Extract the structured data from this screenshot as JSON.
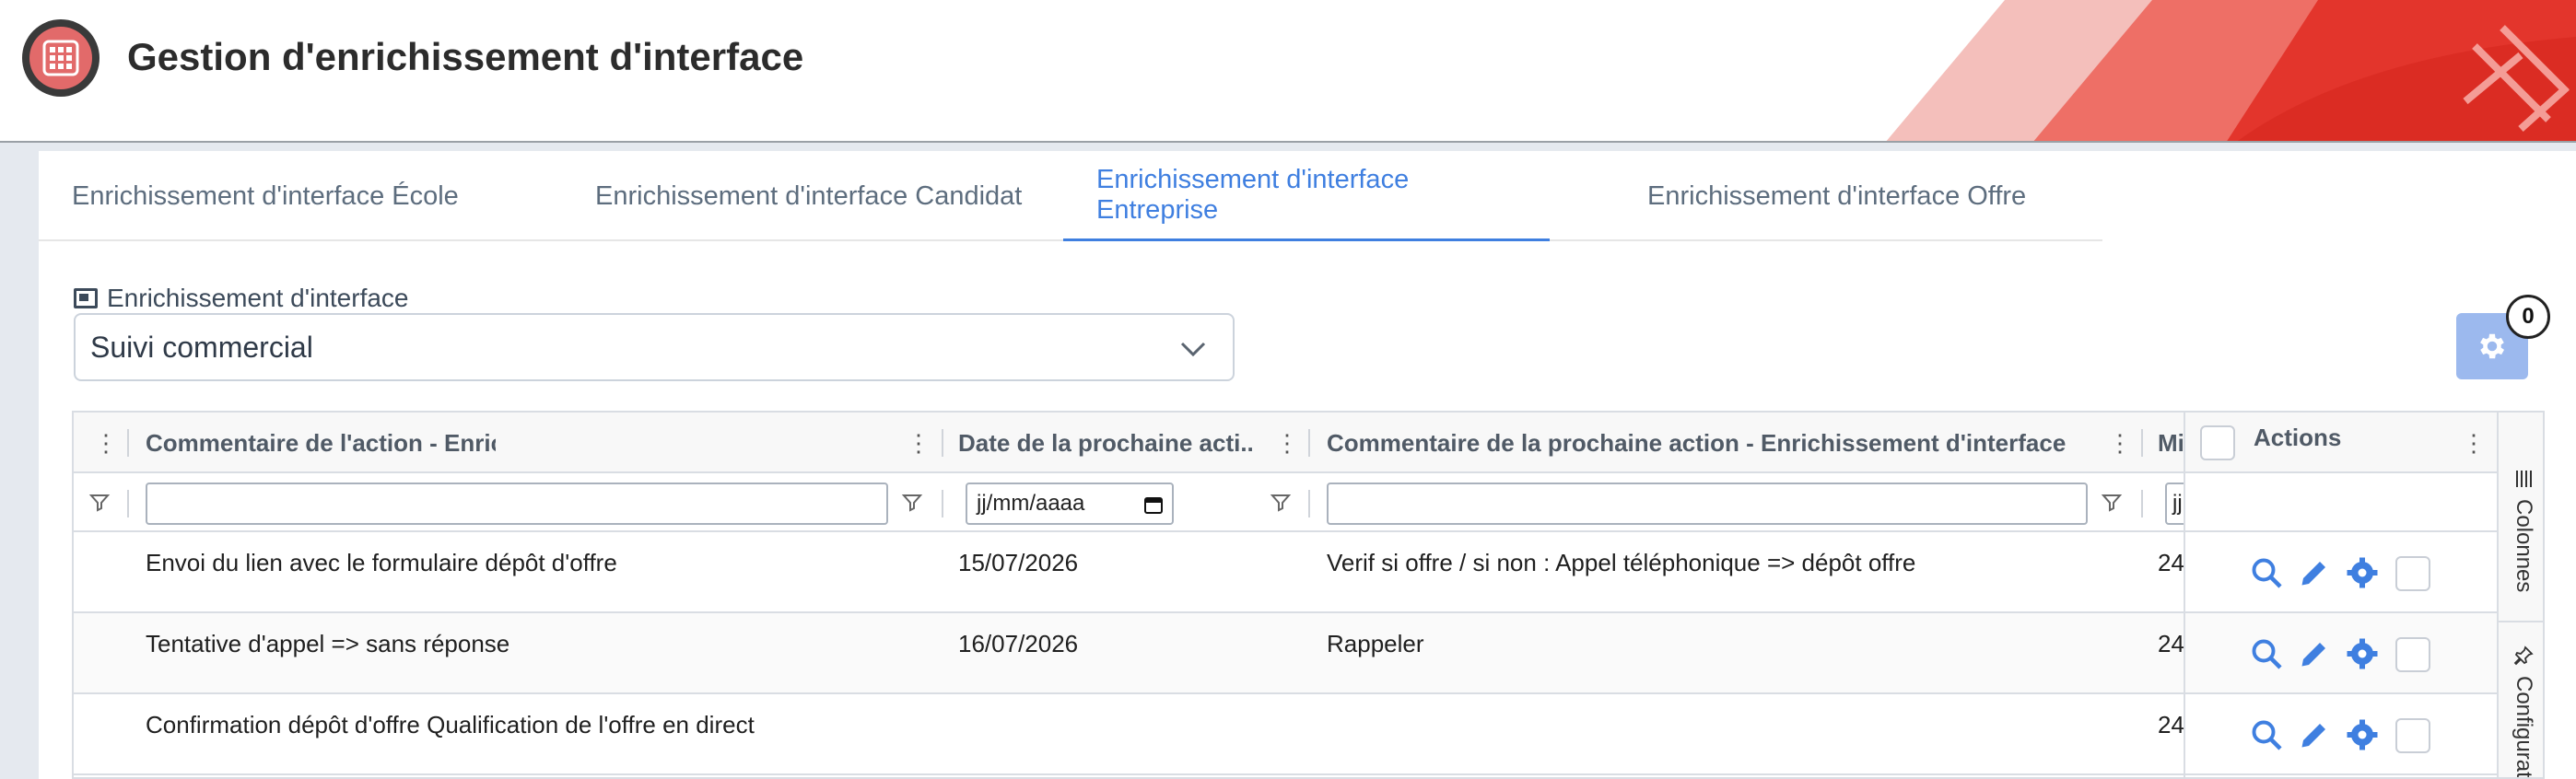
{
  "header": {
    "title": "Gestion d'enrichissement d'interface",
    "logo_icon": "grid-icon",
    "accent_color": "#e8574f"
  },
  "tabs": [
    {
      "label": "Enrichissement d'interface École",
      "active": false
    },
    {
      "label": "Enrichissement d'interface Candidat",
      "active": false
    },
    {
      "label": "Enrichissement d'interface Entreprise",
      "active": true
    },
    {
      "label": "Enrichissement d'interface Offre",
      "active": false
    }
  ],
  "selector": {
    "label": "Enrichissement d'interface",
    "value": "Suivi commercial"
  },
  "settings": {
    "badge_count": "0"
  },
  "grid": {
    "columns": [
      {
        "label": "Commentaire de l'action - Enrichissement d'interface"
      },
      {
        "label": "Date de la prochaine acti..."
      },
      {
        "label": "Commentaire de la prochaine action - Enrichissement d'interface"
      },
      {
        "label": "Mi"
      }
    ],
    "date_filter_placeholder": "jj/mm/aaaa",
    "partial_filter_placeholder": "jj",
    "actions_label": "Actions",
    "rows": [
      {
        "comment": "Envoi du lien avec le formulaire dépôt d'offre",
        "next_date": "15/07/2026",
        "next_comment": "Verif si offre / si non : Appel téléphonique => dépôt offre",
        "partial": "24"
      },
      {
        "comment": "Tentative d'appel => sans réponse",
        "next_date": "16/07/2026",
        "next_comment": "Rappeler",
        "partial": "24"
      },
      {
        "comment": "Confirmation dépôt d'offre Qualification de l'offre en direct",
        "next_date": "",
        "next_comment": "",
        "partial": "24"
      }
    ]
  },
  "sidebar": {
    "columns_label": "Colonnes",
    "config_label": "Configuration"
  }
}
